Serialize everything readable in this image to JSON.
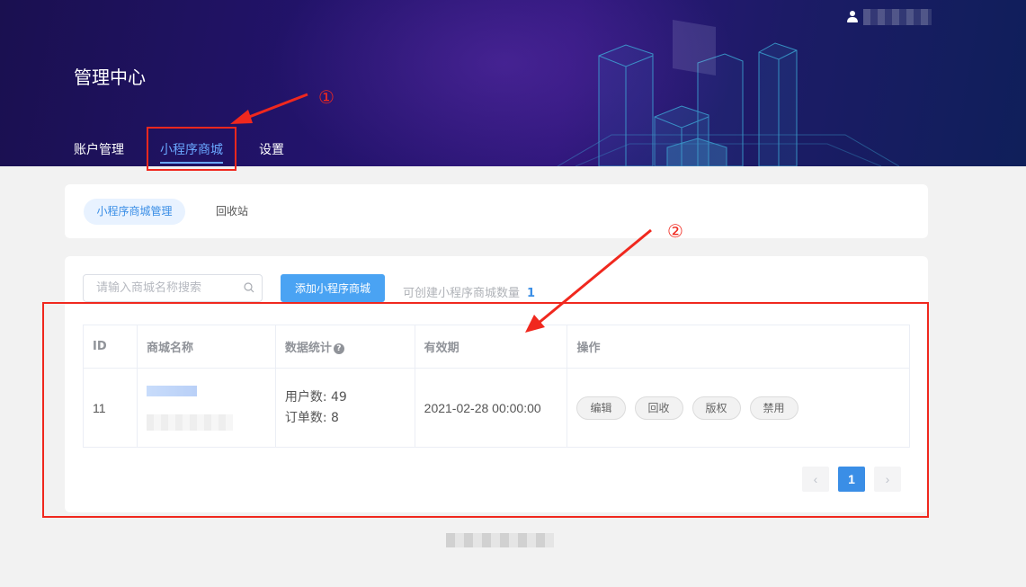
{
  "header": {
    "title": "管理中心",
    "nav": [
      {
        "label": "账户管理",
        "active": false
      },
      {
        "label": "小程序商城",
        "active": true
      },
      {
        "label": "设置",
        "active": false
      }
    ],
    "user_icon": "user-icon"
  },
  "annotations": {
    "step1": "①",
    "step2": "②",
    "color": "#f0281e"
  },
  "sub_tabs": [
    {
      "label": "小程序商城管理",
      "active": true
    },
    {
      "label": "回收站",
      "active": false
    }
  ],
  "toolbar": {
    "search_placeholder": "请输入商城名称搜索",
    "search_icon": "search-icon",
    "add_button": "添加小程序商城",
    "quota_label": "可创建小程序商城数量",
    "quota_value": "1"
  },
  "table": {
    "columns": [
      "ID",
      "商城名称",
      "数据统计",
      "有效期",
      "操作"
    ],
    "rows": [
      {
        "id": "11",
        "users": "用户数: 49",
        "orders": "订单数: 8",
        "expiry": "2021-02-28 00:00:00",
        "actions": [
          "编辑",
          "回收",
          "版权",
          "禁用"
        ]
      }
    ]
  },
  "pagination": {
    "prev": "‹",
    "current": "1",
    "next": "›"
  },
  "colors": {
    "accent": "#3a8ee6",
    "button": "#4aa3f3",
    "header_bg": "#22136a"
  }
}
